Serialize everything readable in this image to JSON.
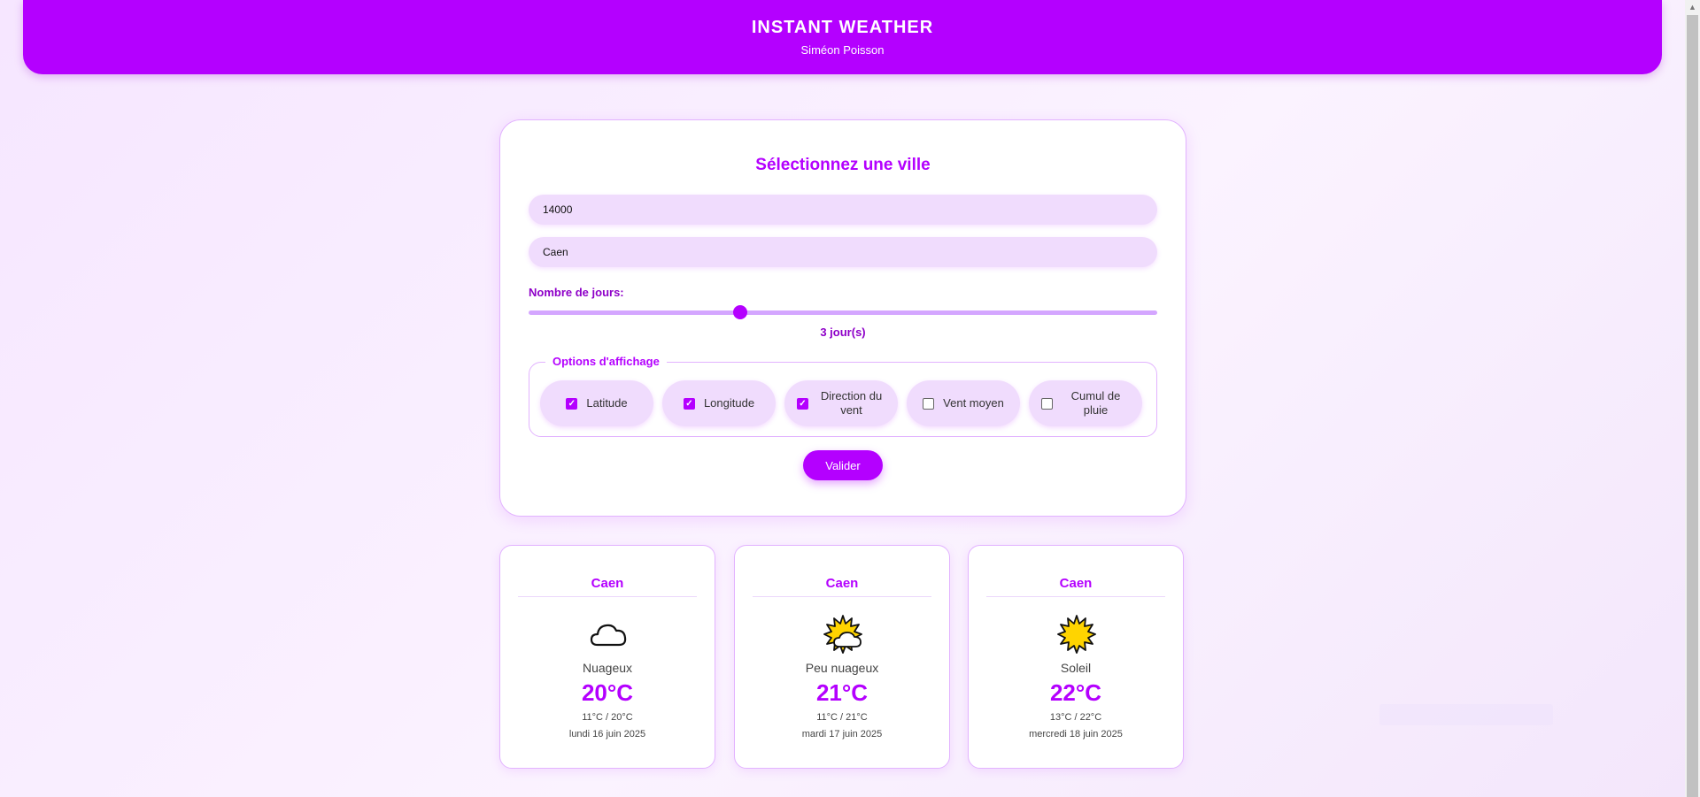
{
  "header": {
    "title": "INSTANT WEATHER",
    "subtitle": "Siméon Poisson"
  },
  "form": {
    "heading": "Sélectionnez une ville",
    "postal_code_value": "14000",
    "city_value": "Caen",
    "days_label": "Nombre de jours:",
    "days_slider_value": 3,
    "days_value_text": "3 jour(s)",
    "options_legend": "Options d'affichage",
    "options": [
      {
        "label": "Latitude",
        "checked": true
      },
      {
        "label": "Longitude",
        "checked": true
      },
      {
        "label": "Direction du vent",
        "checked": true
      },
      {
        "label": "Vent moyen",
        "checked": false
      },
      {
        "label": "Cumul de pluie",
        "checked": false
      }
    ],
    "submit_label": "Valider"
  },
  "forecast": [
    {
      "city": "Caen",
      "icon": "cloud-icon",
      "condition": "Nuageux",
      "temp": "20°C",
      "minmax": "11°C / 20°C",
      "date": "lundi 16 juin 2025"
    },
    {
      "city": "Caen",
      "icon": "sun-behind-cloud-icon",
      "condition": "Peu nuageux",
      "temp": "21°C",
      "minmax": "11°C / 21°C",
      "date": "mardi 17 juin 2025"
    },
    {
      "city": "Caen",
      "icon": "sun-icon",
      "condition": "Soleil",
      "temp": "22°C",
      "minmax": "13°C / 22°C",
      "date": "mercredi 18 juin 2025"
    }
  ],
  "colors": {
    "accent": "#b400ff",
    "field_bg": "#f0dcfd",
    "border": "#e2b3ff"
  }
}
